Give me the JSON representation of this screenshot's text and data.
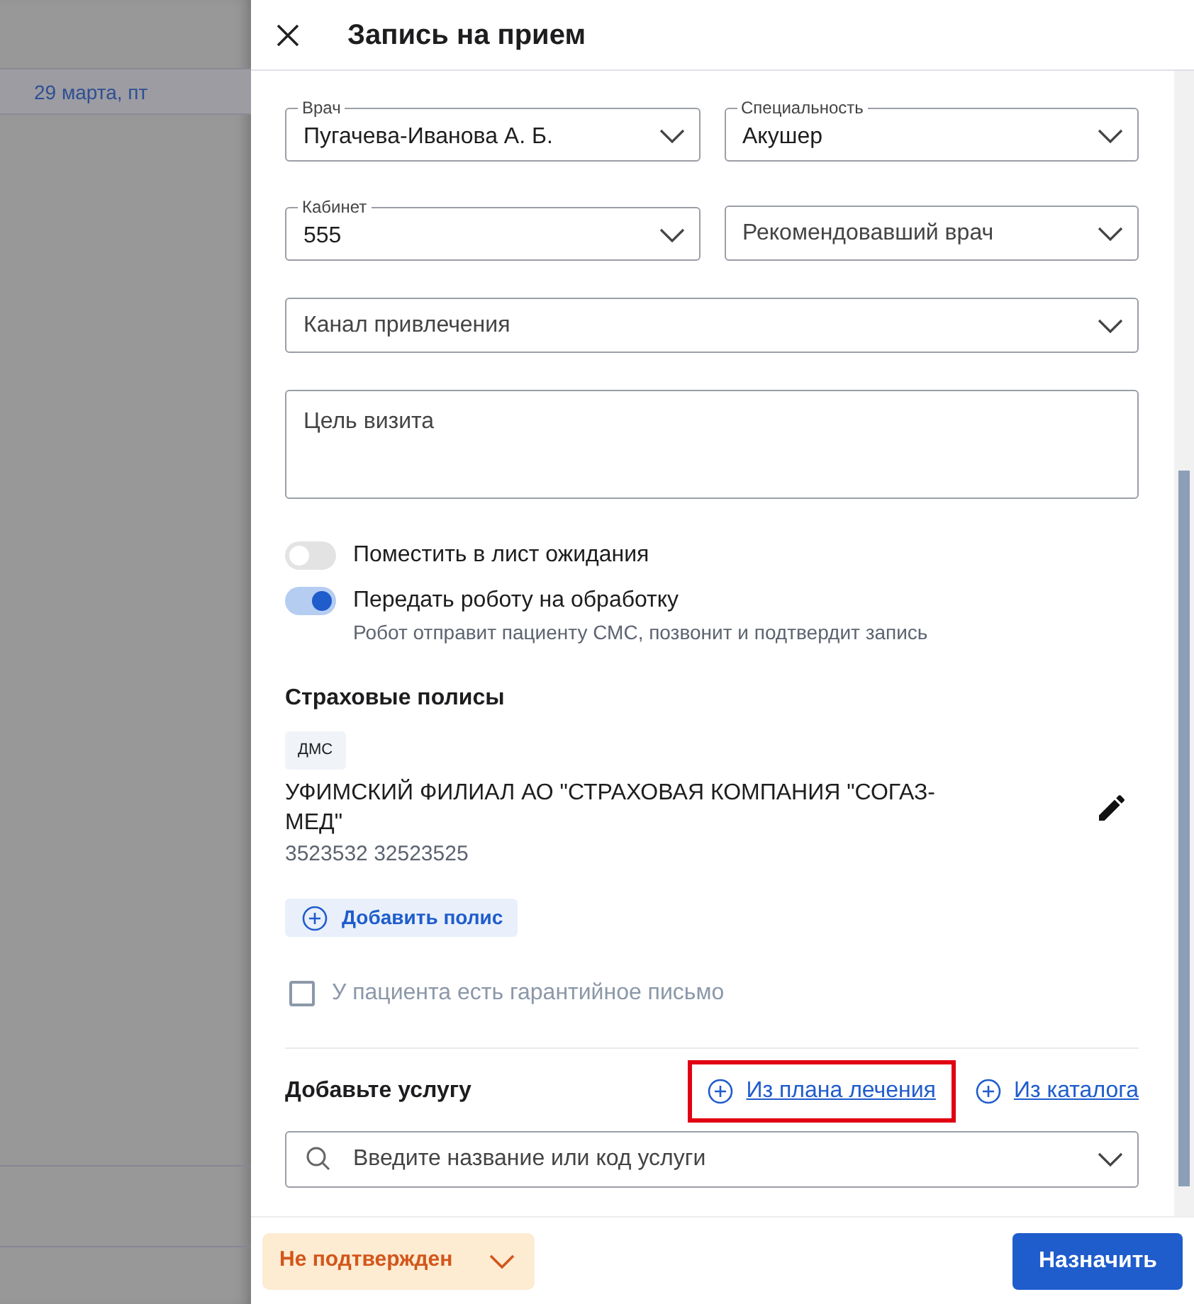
{
  "background": {
    "date": "29 марта, пт"
  },
  "drawer": {
    "title": "Запись на прием",
    "fields": [
      {
        "kind": "select",
        "label": "Врач",
        "value": "Пугачева-Иванова А. Б."
      },
      {
        "kind": "select",
        "label": "Специальность",
        "value": "Акушер"
      },
      {
        "kind": "select",
        "label": "Кабинет",
        "value": "555"
      },
      {
        "kind": "select",
        "placeholder": "Рекомендовавший врач"
      },
      {
        "kind": "select-wide",
        "placeholder": "Канал привлечения"
      },
      {
        "kind": "textarea",
        "placeholder": "Цель визита"
      }
    ],
    "toggles": [
      {
        "label": "Поместить в лист ожидания",
        "on": false
      },
      {
        "label": "Передать роботу на обработку",
        "on": true,
        "hint": "Робот отправит пациенту СМС, позвонит и подтвердит запись"
      }
    ],
    "insurance": {
      "title": "Страховые полисы",
      "policies": [
        {
          "type": "ДМС",
          "company": "УФИМСКИЙ ФИЛИАЛ АО \"СТРАХОВАЯ КОМПАНИЯ \"СОГАЗ-МЕД\"",
          "number": "3523532 32523525"
        }
      ],
      "add_button": "Добавить полис"
    },
    "guarantee": {
      "label": "У пациента есть гарантийное письмо",
      "checked": false,
      "disabled": true
    },
    "services": {
      "title": "Добавьте услугу",
      "links": [
        {
          "label": "Из плана лечения",
          "highlighted": true
        },
        {
          "label": "Из каталога",
          "highlighted": false
        }
      ],
      "search": {
        "placeholder": "Введите название или код услуги"
      }
    },
    "footer": {
      "status": "Не подтвержден",
      "submit": "Назначить"
    }
  }
}
